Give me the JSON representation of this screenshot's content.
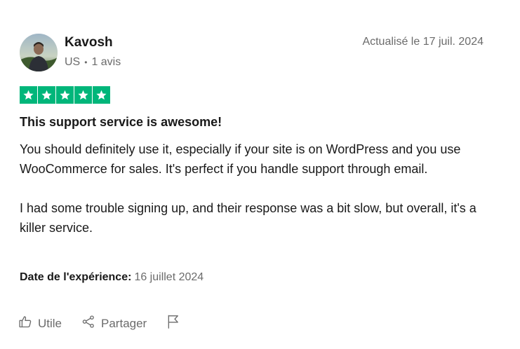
{
  "review": {
    "author": {
      "name": "Kavosh",
      "country": "US",
      "separator": "•",
      "reviews_count": "1 avis"
    },
    "updated": "Actualisé le 17 juil. 2024",
    "rating": 5,
    "star_color": "#00b67a",
    "title": "This support service is awesome!",
    "paragraphs": [
      "You should definitely use it, especially if your site is on WordPress and you use WooCommerce for sales. It's perfect if you handle support through email.",
      "I had some trouble signing up, and their response was a bit slow, but overall, it's a killer service."
    ],
    "experience": {
      "label": "Date de l'expérience:",
      "value": "16 juillet 2024"
    },
    "actions": {
      "useful": "Utile",
      "share": "Partager",
      "useful_icon": "thumbs-up-icon",
      "share_icon": "share-icon",
      "report_icon": "flag-icon"
    }
  }
}
